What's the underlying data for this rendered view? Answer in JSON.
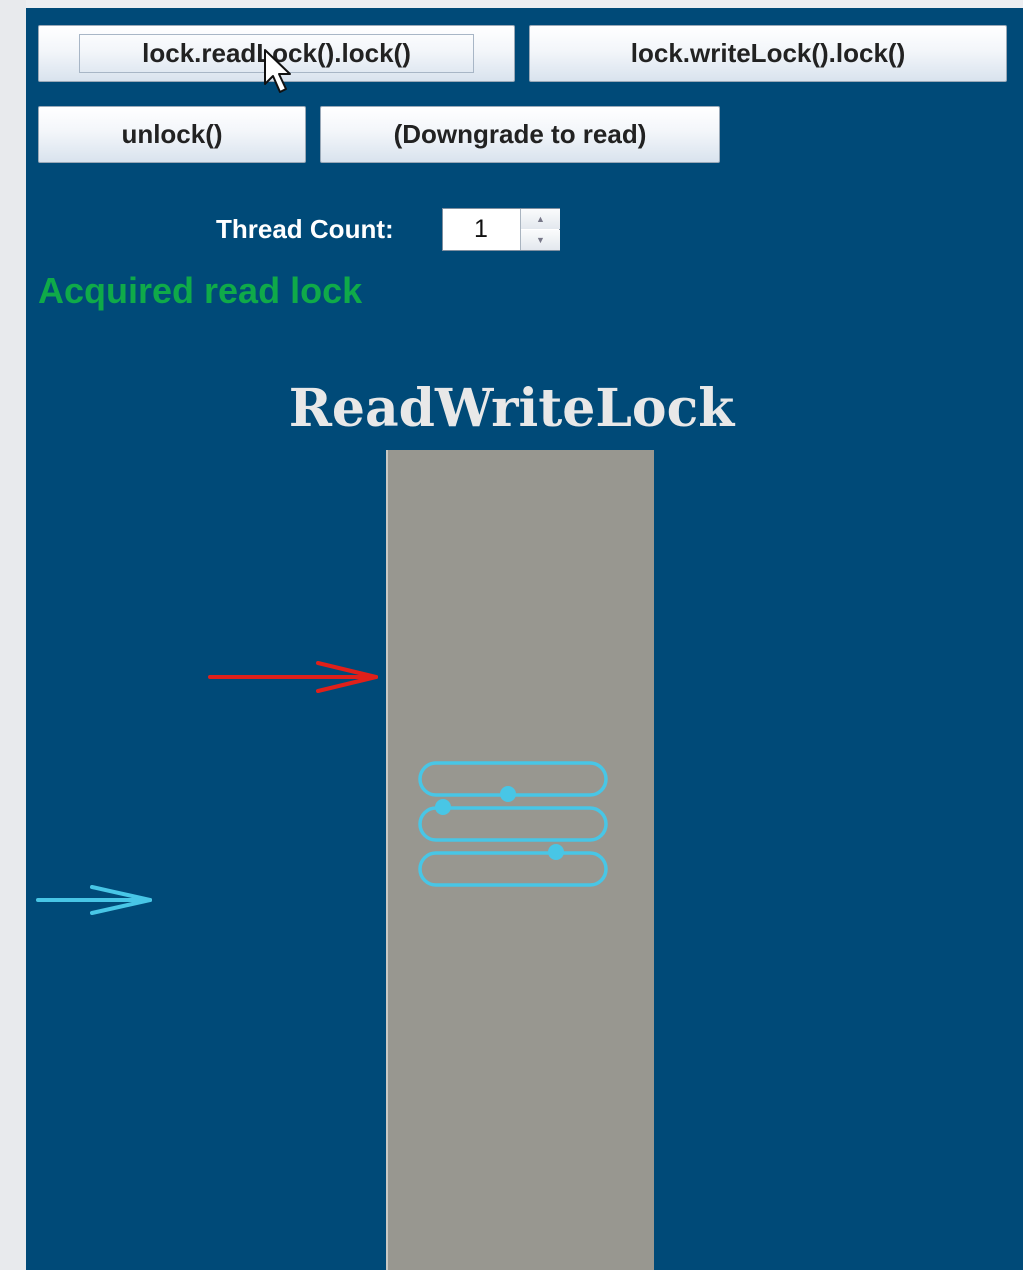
{
  "buttons": {
    "read_lock": "lock.readLock().lock()",
    "write_lock": "lock.writeLock().lock()",
    "unlock": "unlock()",
    "downgrade": "(Downgrade to read)"
  },
  "thread_count": {
    "label": "Thread Count:",
    "value": "1"
  },
  "status": {
    "text": "Acquired read lock",
    "color": "#0faa49"
  },
  "diagram": {
    "title": "ReadWriteLock"
  },
  "colors": {
    "background": "#004a78",
    "column": "#989790",
    "reader": "#48c6e6",
    "writer_arrow": "#e0201a"
  },
  "icons": [
    "mouse-cursor-icon",
    "spinner-up-icon",
    "spinner-down-icon",
    "writer-arrow-icon",
    "reader-arrow-icon"
  ]
}
